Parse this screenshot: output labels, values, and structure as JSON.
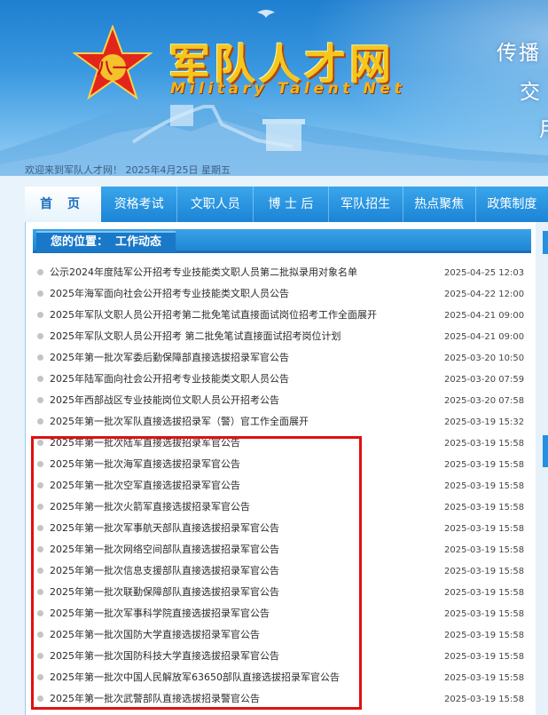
{
  "header": {
    "logo_cn": "军队人才网",
    "logo_en": "Military Talent Net",
    "slogan_lines": [
      "传播",
      "交",
      "用"
    ],
    "welcome": "欢迎来到军队人才网！ 2025年4月25日 星期五"
  },
  "nav": {
    "items": [
      "首 页",
      "资格考试",
      "文职人员",
      "博 士 后",
      "军队招生",
      "热点聚焦",
      "政策制度"
    ]
  },
  "breadcrumb": {
    "label": "您的位置：",
    "current": "工作动态"
  },
  "articles": [
    {
      "title": "公示2024年度陆军公开招考专业技能类文职人员第二批拟录用对象名单",
      "date": "2025-04-25 12:03"
    },
    {
      "title": "2025年海军面向社会公开招考专业技能类文职人员公告",
      "date": "2025-04-22 12:00"
    },
    {
      "title": "2025年军队文职人员公开招考第二批免笔试直接面试岗位招考工作全面展开",
      "date": "2025-04-21 09:00"
    },
    {
      "title": "2025年军队文职人员公开招考 第二批免笔试直接面试招考岗位计划",
      "date": "2025-04-21 09:00"
    },
    {
      "title": "2025年第一批次军委后勤保障部直接选拔招录军官公告",
      "date": "2025-03-20 10:50"
    },
    {
      "title": "2025年陆军面向社会公开招考专业技能类文职人员公告",
      "date": "2025-03-20 07:59"
    },
    {
      "title": "2025年西部战区专业技能岗位文职人员公开招考公告",
      "date": "2025-03-20 07:58"
    },
    {
      "title": "2025年第一批次军队直接选拔招录军（警）官工作全面展开",
      "date": "2025-03-19 15:32"
    },
    {
      "title": "2025年第一批次陆军直接选拔招录军官公告",
      "date": "2025-03-19 15:58"
    },
    {
      "title": "2025年第一批次海军直接选拔招录军官公告",
      "date": "2025-03-19 15:58"
    },
    {
      "title": "2025年第一批次空军直接选拔招录军官公告",
      "date": "2025-03-19 15:58"
    },
    {
      "title": "2025年第一批次火箭军直接选拔招录军官公告",
      "date": "2025-03-19 15:58"
    },
    {
      "title": "2025年第一批次军事航天部队直接选拔招录军官公告",
      "date": "2025-03-19 15:58"
    },
    {
      "title": "2025年第一批次网络空间部队直接选拔招录军官公告",
      "date": "2025-03-19 15:58"
    },
    {
      "title": "2025年第一批次信息支援部队直接选拔招录军官公告",
      "date": "2025-03-19 15:58"
    },
    {
      "title": "2025年第一批次联勤保障部队直接选拔招录军官公告",
      "date": "2025-03-19 15:58"
    },
    {
      "title": "2025年第一批次军事科学院直接选拔招录军官公告",
      "date": "2025-03-19 15:58"
    },
    {
      "title": "2025年第一批次国防大学直接选拔招录军官公告",
      "date": "2025-03-19 15:58"
    },
    {
      "title": "2025年第一批次国防科技大学直接选拔招录军官公告",
      "date": "2025-03-19 15:58"
    },
    {
      "title": "2025年第一批次中国人民解放军63650部队直接选拔招录军官公告",
      "date": "2025-03-19 15:58"
    },
    {
      "title": "2025年第一批次武警部队直接选拔招录警官公告",
      "date": "2025-03-19 15:58"
    }
  ],
  "colors": {
    "nav_blue": "#1b84d6",
    "logo_gold": "#f5c61c",
    "highlight_red": "#e01010"
  }
}
